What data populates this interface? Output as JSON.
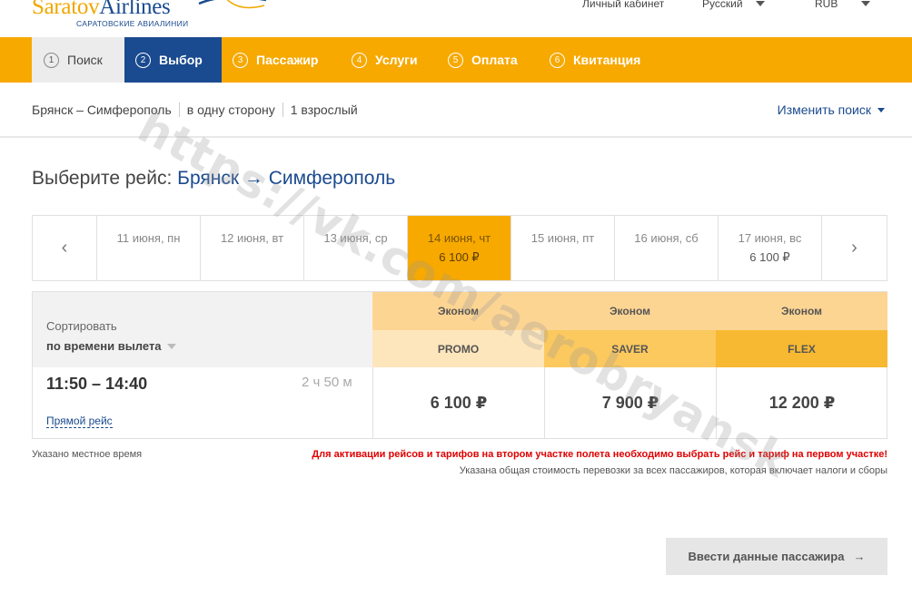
{
  "header": {
    "logo_part1": "Saratov",
    "logo_part2": "Airlines",
    "logo_sub": "САРАТОВСКИЕ АВИАЛИНИИ",
    "account": "Личный кабинет",
    "language": "Русский",
    "currency": "RUB"
  },
  "steps": [
    {
      "num": "1",
      "label": "Поиск",
      "state": "done"
    },
    {
      "num": "2",
      "label": "Выбор",
      "state": "active"
    },
    {
      "num": "3",
      "label": "Пассажир",
      "state": "pending"
    },
    {
      "num": "4",
      "label": "Услуги",
      "state": "pending"
    },
    {
      "num": "5",
      "label": "Оплата",
      "state": "pending"
    },
    {
      "num": "6",
      "label": "Квитанция",
      "state": "pending"
    }
  ],
  "summary": {
    "route": "Брянск – Симферополь",
    "trip_type": "в одну сторону",
    "passengers": "1 взрослый",
    "change_search": "Изменить поиск"
  },
  "title": {
    "prefix": "Выберите рейс:",
    "from": "Брянск",
    "arrow": "→",
    "to": "Симферополь"
  },
  "dates": [
    {
      "date": "11 июня, пн",
      "price": ""
    },
    {
      "date": "12 июня, вт",
      "price": ""
    },
    {
      "date": "13 июня, ср",
      "price": ""
    },
    {
      "date": "14 июня, чт",
      "price": "6 100 ₽",
      "selected": true
    },
    {
      "date": "15 июня, пт",
      "price": ""
    },
    {
      "date": "16 июня, сб",
      "price": ""
    },
    {
      "date": "17 июня, вс",
      "price": "6 100 ₽"
    }
  ],
  "date_nav": {
    "prev": "‹",
    "next": "›"
  },
  "sort": {
    "label": "Сортировать",
    "value": "по времени вылета"
  },
  "fares": [
    {
      "class": "Эконом",
      "tariff": "PROMO"
    },
    {
      "class": "Эконом",
      "tariff": "SAVER"
    },
    {
      "class": "Эконом",
      "tariff": "FLEX"
    }
  ],
  "flight": {
    "times": "11:50 – 14:40",
    "duration": "2 ч 50 м",
    "direct": "Прямой рейс",
    "prices": [
      "6 100 ₽",
      "7 900 ₽",
      "12 200 ₽"
    ]
  },
  "notes": {
    "local_time": "Указано местное время",
    "warning": "Для активации рейсов и тарифов на втором участке полета необходимо выбрать рейс и тариф на первом участке!",
    "total": "Указана общая стоимость перевозки за всех пассажиров, которая включает налоги и сборы"
  },
  "next_button": {
    "label": "Ввести данные пассажира",
    "arrow": "→"
  },
  "watermark": "https://vk.com/aerobryansk",
  "colors": {
    "accent": "#f7a900",
    "brand": "#1a4a8f",
    "warning": "#e00000"
  }
}
